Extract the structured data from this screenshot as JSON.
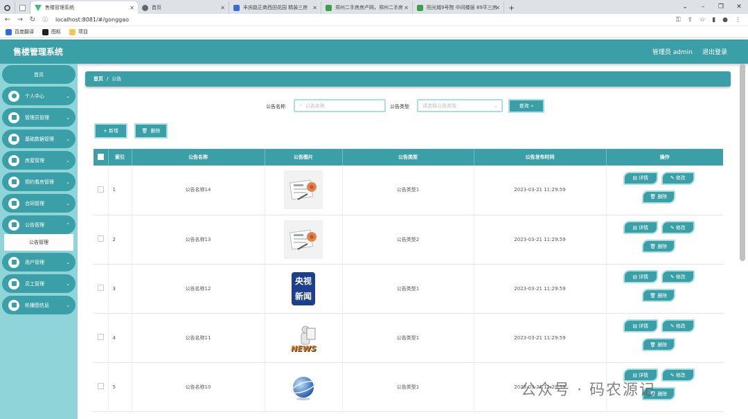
{
  "browser": {
    "tabs": [
      {
        "label": "",
        "icon": "chrome-icon"
      },
      {
        "label": "",
        "icon": "page-icon"
      },
      {
        "label": "售楼管理系统",
        "icon": "vue-icon"
      },
      {
        "label": "首页",
        "icon": "globe-icon"
      },
      {
        "label": "丰庆路正商西田花园 精装三房",
        "icon": "site-icon"
      },
      {
        "label": "郑州二手房房产网，郑州二手房",
        "icon": "anjuke-icon"
      },
      {
        "label": "阳光城9号院 中间楼层 89平三房",
        "icon": "anjuke-icon"
      }
    ],
    "url": "localhost:8081/#/gonggao",
    "bookmarks": [
      "百度翻译",
      "图标",
      "项目"
    ]
  },
  "header": {
    "title": "售楼管理系统",
    "user": "管理员 admin",
    "logout": "退出登录"
  },
  "sidebar": {
    "home": "首页",
    "items": [
      {
        "label": "个人中心"
      },
      {
        "label": "管理员管理"
      },
      {
        "label": "基础数据管理"
      },
      {
        "label": "房屋管理"
      },
      {
        "label": "预约看房管理"
      },
      {
        "label": "合同管理"
      },
      {
        "label": "公告管理"
      },
      {
        "label": "用户管理"
      },
      {
        "label": "员工管理"
      },
      {
        "label": "轮播图信息"
      }
    ],
    "active_sub": "公告管理"
  },
  "breadcrumb": {
    "home": "首页",
    "sep": "/",
    "current": "公告"
  },
  "search": {
    "name_label": "公告名称",
    "name_placeholder": "公告名称",
    "type_label": "公告类型",
    "type_placeholder": "请选择公告类型",
    "query": "查询"
  },
  "actions": {
    "add": "+ 新增",
    "delete": "删除"
  },
  "table": {
    "headers": [
      "",
      "索引",
      "公告名称",
      "公告图片",
      "公告类型",
      "公告发布时间",
      "操作"
    ],
    "ops": {
      "detail": "详情",
      "edit": "修改",
      "delete": "删除"
    },
    "rows": [
      {
        "index": "1",
        "name": "公告名称14",
        "type": "公告类型1",
        "time": "2023-03-21 11:29:59",
        "image": "news-paper"
      },
      {
        "index": "2",
        "name": "公告名称13",
        "type": "公告类型2",
        "time": "2023-03-21 11:29:59",
        "image": "news-paper"
      },
      {
        "index": "3",
        "name": "公告名称12",
        "type": "公告类型1",
        "time": "2023-03-21 11:29:59",
        "image": "cctv-news",
        "image_text": [
          "央视",
          "新闻"
        ]
      },
      {
        "index": "4",
        "name": "公告名称11",
        "type": "公告类型1",
        "time": "2023-03-21 11:29:59",
        "image": "news-figure",
        "image_text": [
          "NEWS"
        ]
      },
      {
        "index": "5",
        "name": "公告名称10",
        "type": "公告类型1",
        "time": "2023-03-21 11:29:59",
        "image": "globe"
      }
    ]
  },
  "watermark": "公众号 · 码农源记"
}
